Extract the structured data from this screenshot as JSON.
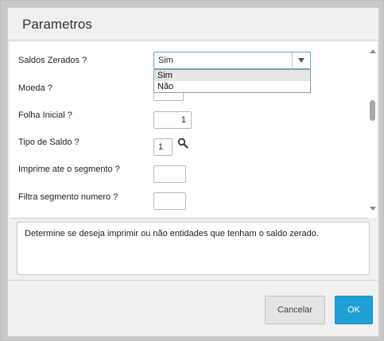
{
  "dialog": {
    "title": "Parametros"
  },
  "form": {
    "saldos_zerados": {
      "label": "Saldos Zerados ?",
      "value": "Sim",
      "options": [
        "Sim",
        "Não"
      ],
      "highlighted_option": "Sim"
    },
    "moeda": {
      "label": "Moeda ?",
      "value": ""
    },
    "folha_inicial": {
      "label": "Folha Inicial ?",
      "value": "1"
    },
    "tipo_de_saldo": {
      "label": "Tipo de Saldo ?",
      "value": "1",
      "lookup_icon": "search-icon"
    },
    "imprime_segmento": {
      "label": "Imprime ate o segmento ?",
      "value": ""
    },
    "filtra_segmento": {
      "label": "Filtra segmento numero ?",
      "value": ""
    }
  },
  "help": {
    "text": "Determine se deseja imprimir ou não entidades que tenham o saldo zerado."
  },
  "buttons": {
    "cancel_label": "Cancelar",
    "ok_label": "OK"
  },
  "colors": {
    "ok_button": "#1f9fd4",
    "focus_border": "#59a8d6"
  }
}
